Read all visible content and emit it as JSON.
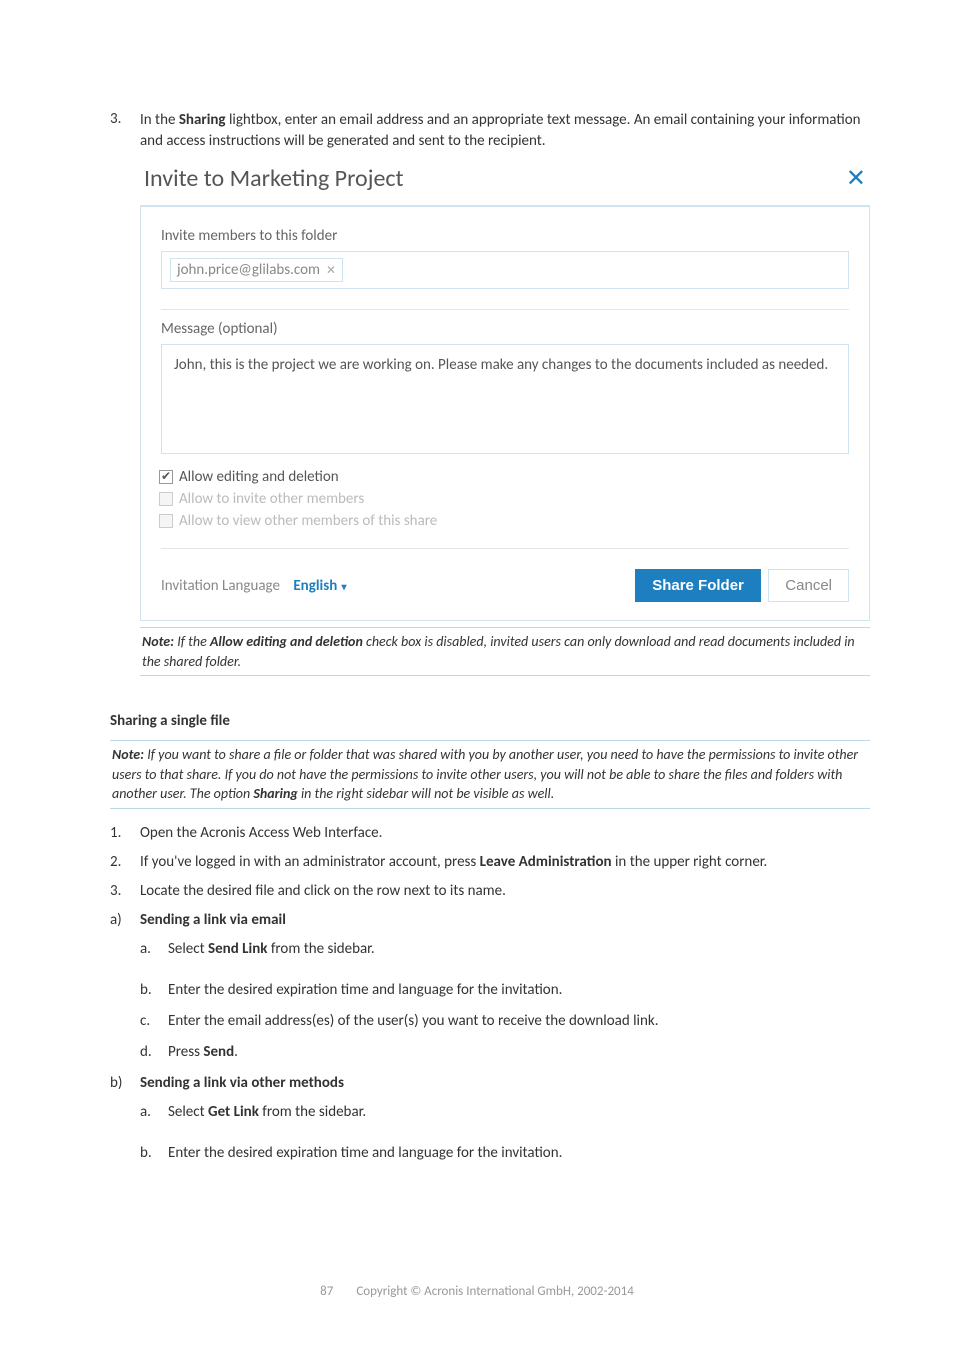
{
  "step3": {
    "number": "3.",
    "text_pre": "In the ",
    "bold1": "Sharing",
    "text_post": " lightbox, enter an email address and an appropriate text message. An email containing your information and access instructions will be generated and sent to the recipient."
  },
  "dialog": {
    "title": "Invite to Marketing Project",
    "invite_label": "Invite members to this folder",
    "email_chip": "john.price@glilabs.com",
    "message_label": "Message (optional)",
    "message_value": "John, this is the project we are working on. Please make any changes to the documents included as needed.",
    "cb1": "Allow editing and deletion",
    "cb2": "Allow to invite other members",
    "cb3": "Allow to view other members of this share",
    "lang_label": "Invitation Language",
    "lang_value": "English",
    "share_btn": "Share Folder",
    "cancel_btn": "Cancel"
  },
  "note1": {
    "pre": "Note:",
    "body_a": " If the ",
    "bold": "Allow editing and deletion",
    "body_b": " check box is disabled, invited users can only download and read documents included in the shared folder."
  },
  "heading": "Sharing a single file",
  "note2": {
    "pre": "Note:",
    "body_a": " If you want to share a file or folder that was shared with you by another user, you need to have the permissions to invite other users to that share. If you do not have the permissions to invite other users, you will not be able to share the files and folders with another user. The option ",
    "bold": "Sharing",
    "body_b": " in the right sidebar will not be visible as well."
  },
  "steps": {
    "s1": "Open the Acronis Access Web Interface.",
    "s2_a": "If you've logged in with an administrator account, press ",
    "s2_bold": "Leave Administration",
    "s2_b": " in the upper right corner.",
    "s3": "Locate the desired file and click on the row next to its name.",
    "a_label": "Sending a link via email",
    "a_a_pre": "Select ",
    "a_a_bold": "Send Link",
    "a_a_post": " from the sidebar.",
    "a_b": "Enter the desired expiration time and language for the invitation.",
    "a_c": "Enter the email address(es) of the user(s) you want to receive the download link.",
    "a_d_pre": "Press ",
    "a_d_bold": "Send",
    "a_d_post": ".",
    "b_label": "Sending a link via other methods",
    "b_a_pre": "Select ",
    "b_a_bold": "Get Link",
    "b_a_post": " from the sidebar.",
    "b_b": "Enter the desired expiration time and language for the invitation."
  },
  "footer": {
    "page": "87",
    "copy": "Copyright © Acronis International GmbH, 2002-2014"
  }
}
